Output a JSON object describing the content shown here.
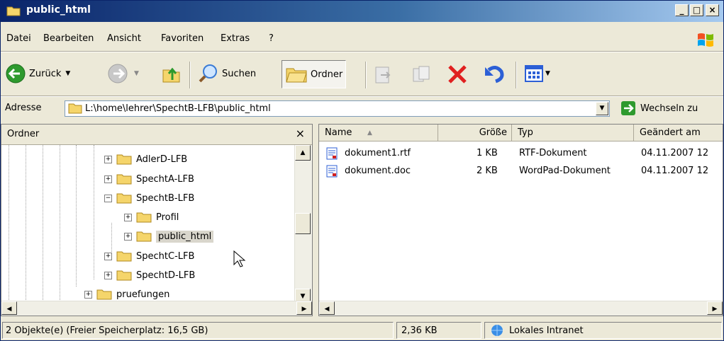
{
  "window": {
    "title": "public_html"
  },
  "menu": [
    "Datei",
    "Bearbeiten",
    "Ansicht",
    "Favoriten",
    "Extras",
    "?"
  ],
  "toolbar": {
    "back_label": "Zurück",
    "search_label": "Suchen",
    "folders_label": "Ordner"
  },
  "address": {
    "label": "Adresse",
    "value": "L:\\home\\lehrer\\SpechtB-LFB\\public_html",
    "go_label": "Wechseln zu"
  },
  "folders_pane": {
    "title": "Ordner",
    "close": "×",
    "tree": [
      {
        "label": "AdlerD-LFB",
        "expander": "+"
      },
      {
        "label": "SpechtA-LFB",
        "expander": "+"
      },
      {
        "label": "SpechtB-LFB",
        "expander": "−"
      },
      {
        "label": "Profil",
        "expander": "+"
      },
      {
        "label": "public_html",
        "expander": "+"
      },
      {
        "label": "SpechtC-LFB",
        "expander": "+"
      },
      {
        "label": "SpechtD-LFB",
        "expander": "+"
      },
      {
        "label": "pruefungen",
        "expander": "+"
      }
    ]
  },
  "files_pane": {
    "columns": [
      "Name",
      "Größe",
      "Typ",
      "Geändert am"
    ],
    "rows": [
      {
        "name": "dokument1.rtf",
        "size": "1 KB",
        "type": "RTF-Dokument",
        "modified": "04.11.2007 12"
      },
      {
        "name": "dokument.doc",
        "size": "2 KB",
        "type": "WordPad-Dokument",
        "modified": "04.11.2007 12"
      }
    ]
  },
  "status": {
    "objects": "2 Objekte(e) (Freier Speicherplatz: 16,5 GB)",
    "size": "2,36 KB",
    "zone": "Lokales Intranet"
  },
  "colors": {
    "titlebar": "#0a246a",
    "window_bg": "#ece9d8",
    "accent_green": "#2e8b2e",
    "delete_red": "#e02020"
  }
}
